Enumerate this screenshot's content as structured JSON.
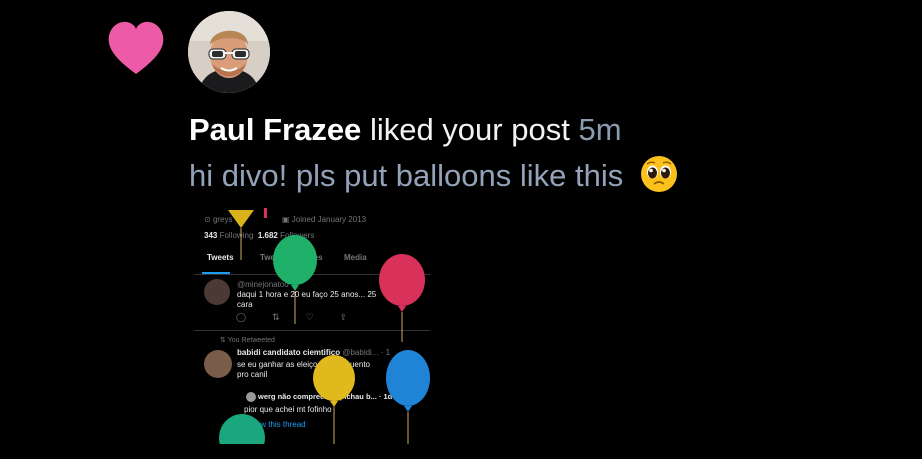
{
  "notification": {
    "icon": "heart-icon",
    "heart_color": "#ec5aa8",
    "user_name": "Paul Frazee",
    "action": "liked your post",
    "time": "5m",
    "post_text": "hi divo! pls put balloons like this",
    "post_emoji": "pleading-face-emoji"
  },
  "embed": {
    "location": "greys",
    "joined": "Joined January 2013",
    "following_count": "343",
    "following_label": "Following",
    "followers_count": "1.682",
    "followers_label": "Followers",
    "tabs": [
      "Tweets",
      "Tweets & replies",
      "Media"
    ],
    "tweet1": {
      "handle": "@minejonatoo",
      "text_line1": "daqui 1 hora e 20 eu faço 25 anos... 25",
      "text_line2": "cara"
    },
    "retweet_label": "You Retweeted",
    "tweet2": {
      "name": "babidi candidato ciemtifico",
      "handle": "@babidi... · 1",
      "text_line1": "se eu ganhar as eleiçoes... pulguento",
      "text_line2": "pro canil"
    },
    "quote": {
      "name": "werg não compreende pichau b... · 1d",
      "text": "pior que achei mt fofinho"
    },
    "show_thread": "Show this thread",
    "balloon_colors": [
      "#d9b21a",
      "#1fb06a",
      "#d8325a",
      "#e0b91c",
      "#1f83d6",
      "#1aa77d"
    ]
  }
}
